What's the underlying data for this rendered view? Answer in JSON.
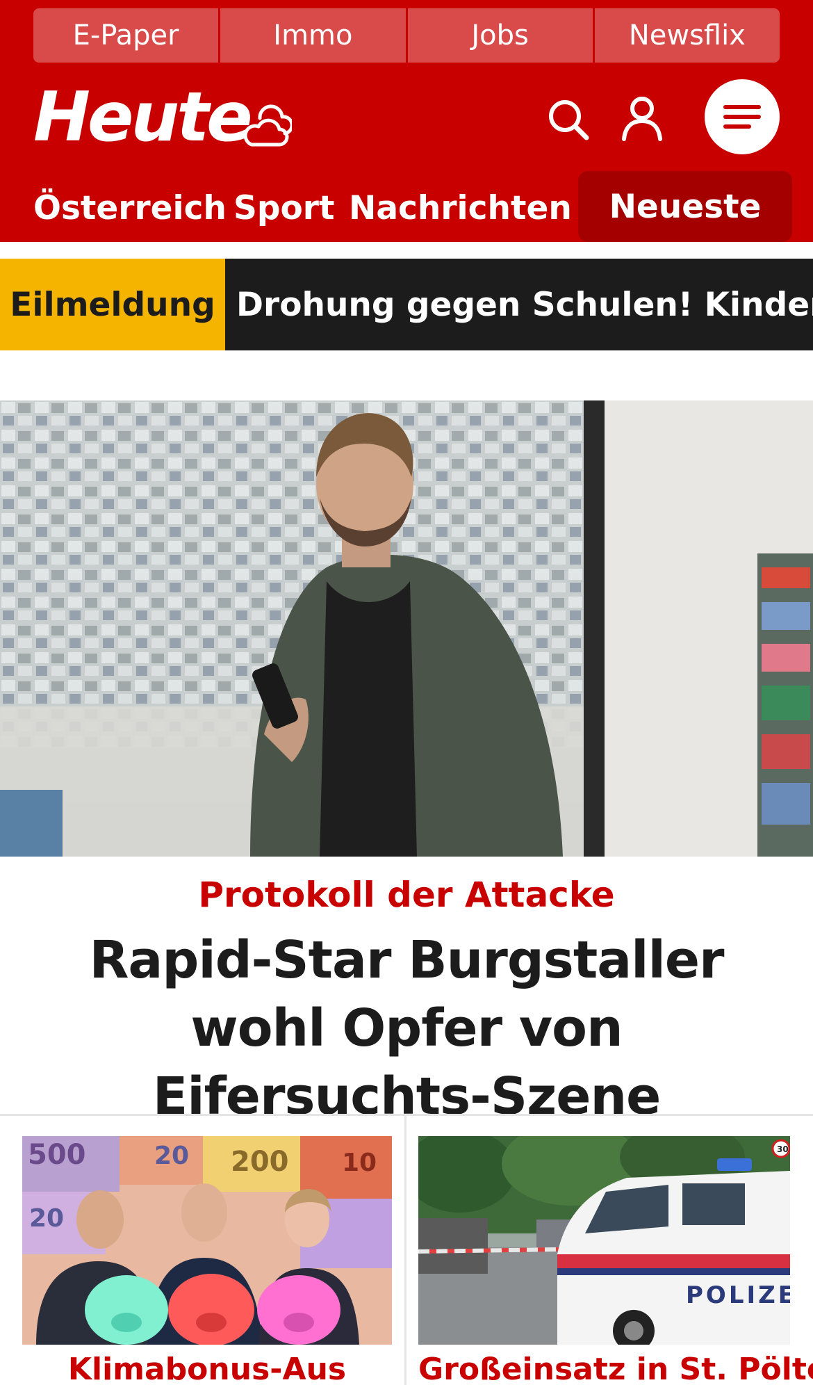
{
  "top_tabs": [
    "E-Paper",
    "Immo",
    "Jobs",
    "Newsflix"
  ],
  "brand": {
    "logo": "Heute"
  },
  "nav": {
    "items": [
      "Österreich",
      "Sport",
      "Nachrichten"
    ],
    "active": "Neueste"
  },
  "breaking": {
    "label": "Eilmeldung",
    "text": "Drohung gegen Schulen! Kinder müss"
  },
  "hero": {
    "kicker": "Protokoll der Attacke",
    "title": "Rapid-Star Burgstaller wohl Opfer von Eifersuchts-Szene"
  },
  "cards": [
    {
      "kicker": "Klimabonus-Aus",
      "banknote_labels": [
        "500",
        "20",
        "200",
        "10",
        "20"
      ]
    },
    {
      "kicker": "Großeinsatz in St. Pölten",
      "vehicle_text": "POLIZE",
      "sign_text": "30"
    }
  ],
  "colors": {
    "brand_red": "#c80000",
    "active_nav": "#a50000",
    "breaking_yellow": "#f4b400",
    "breaking_bg": "#1c1c1c"
  },
  "icons": [
    "weather-cloud-sun-icon",
    "search-icon",
    "user-icon",
    "menu-icon"
  ]
}
